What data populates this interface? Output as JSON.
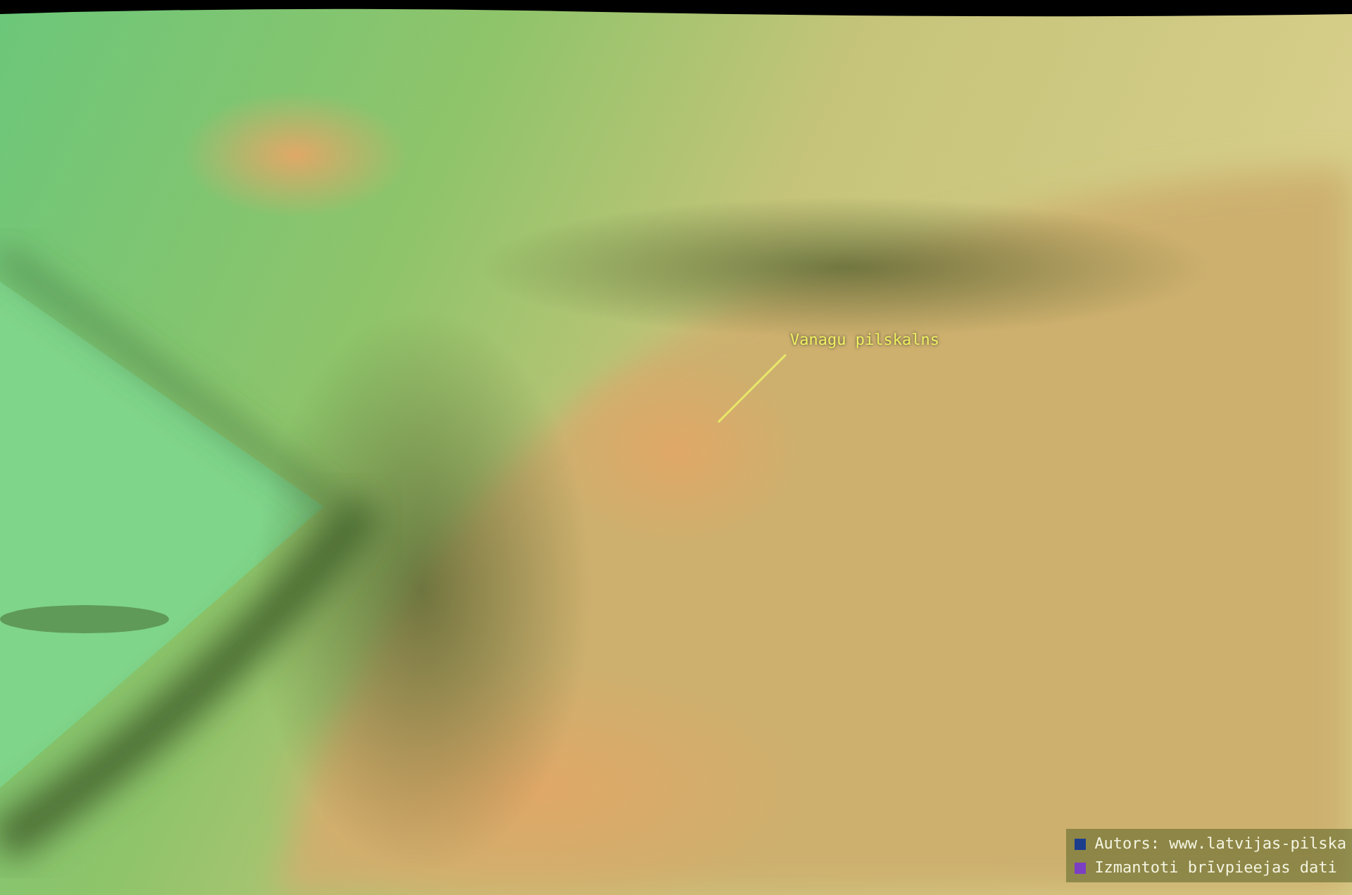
{
  "map_label": {
    "text": "Vanagu pilskalns"
  },
  "legend": {
    "items": [
      {
        "text": "Autors: www.latvijas-pilska",
        "color": "#1c3c8c"
      },
      {
        "text": "Izmantoti brīvpieejas dati",
        "color": "#7b3fc4"
      }
    ]
  }
}
